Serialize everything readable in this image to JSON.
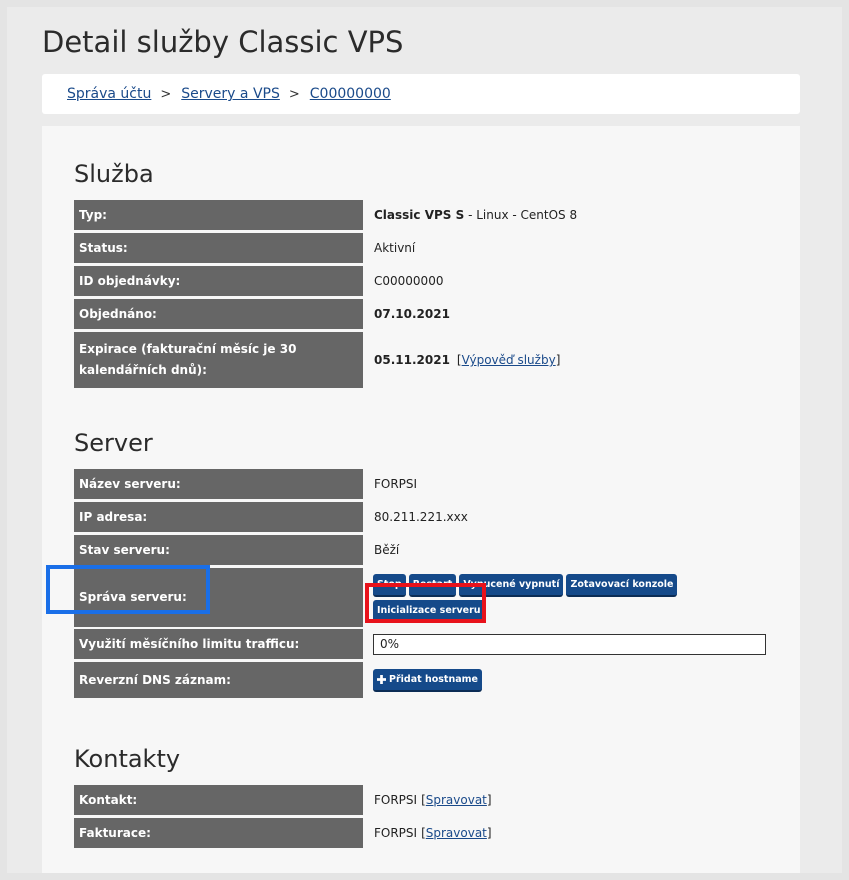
{
  "page": {
    "title": "Detail služby Classic VPS"
  },
  "breadcrumb": {
    "items": [
      "Správa účtu",
      "Servery a VPS",
      "C00000000"
    ],
    "separator": ">"
  },
  "sluzba": {
    "title": "Služba",
    "typ_label": "Typ:",
    "typ_bold": "Classic VPS S",
    "typ_rest": " - Linux - CentOS 8",
    "status_label": "Status:",
    "status_value": "Aktivní",
    "id_label": "ID objednávky:",
    "id_value": "C00000000",
    "objednano_label": "Objednáno:",
    "objednano_value": "07.10.2021",
    "expirace_label": "Expirace (fakturační měsíc je 30 kalendářních dnů):",
    "expirace_value": "05.11.2021",
    "vypoved_open": "[",
    "vypoved_link": "Výpověď služby",
    "vypoved_close": "]"
  },
  "server": {
    "title": "Server",
    "nazev_label": "Název serveru:",
    "nazev_value": "FORPSI",
    "ip_label": "IP adresa:",
    "ip_value": "80.211.221.xxx",
    "stav_label": "Stav serveru:",
    "stav_value": "Běží",
    "sprava_label": "Správa serveru:",
    "buttons": {
      "stop": "Stop",
      "restart": "Restart",
      "vynucene": "Vynucené vypnutí",
      "konzole": "Zotavovací konzole",
      "inicializace": "Inicializace serveru"
    },
    "traffic_label": "Využití měsíčního limitu trafficu:",
    "traffic_value": "0%",
    "dns_label": "Reverzní DNS záznam:",
    "dns_button": "Přidat hostname"
  },
  "kontakty": {
    "title": "Kontakty",
    "kontakt_label": "Kontakt:",
    "kontakt_value": "FORPSI",
    "faktura_label": "Fakturace:",
    "faktura_value": "FORPSI",
    "spravovat_open": "[",
    "spravovat_link": "Spravovat",
    "spravovat_close": "]"
  },
  "colors": {
    "label_bg": "#666666",
    "button_bg": "#154a8a",
    "highlight_blue": "#1a6fe8",
    "highlight_red": "#e8121b"
  },
  "icons": {
    "add": "plus-icon"
  }
}
